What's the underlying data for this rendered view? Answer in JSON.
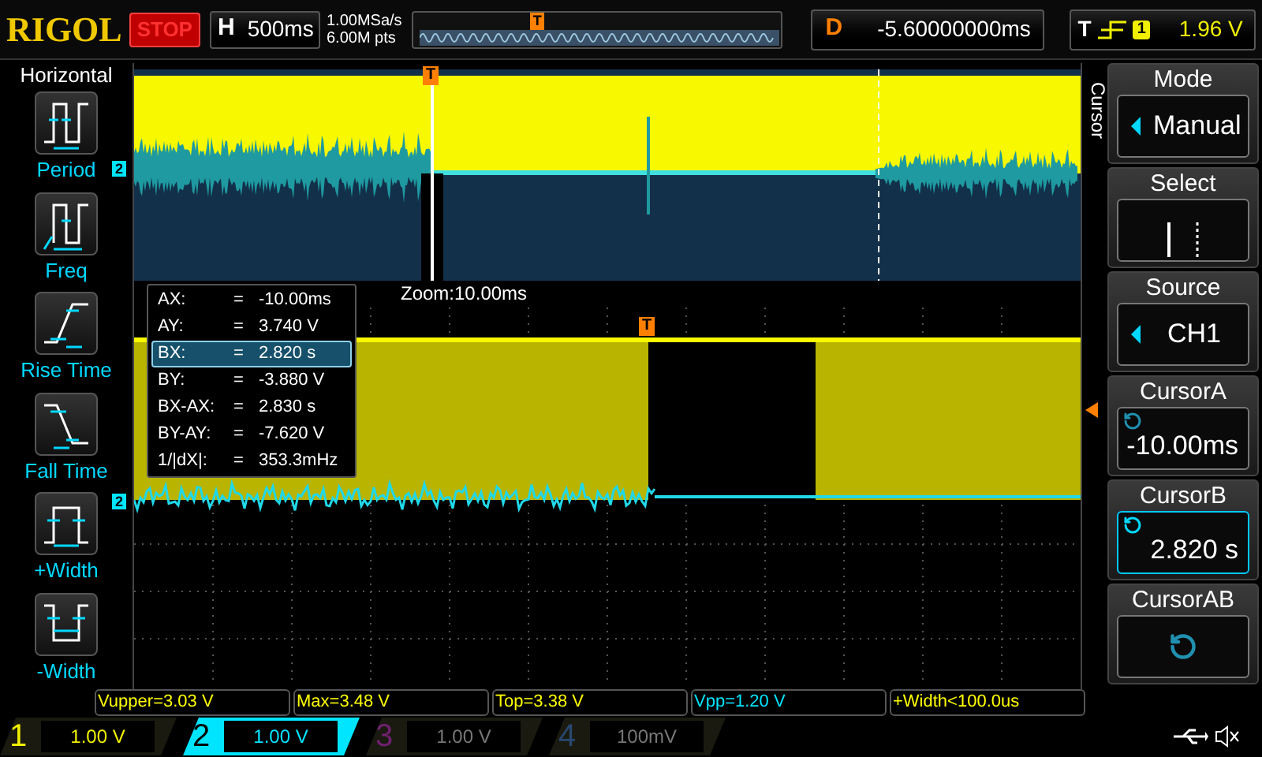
{
  "header": {
    "brand": "RIGOL",
    "run_state": "STOP",
    "timebase_label": "H",
    "timebase": "500ms",
    "sample_rate": "1.00MSa/s",
    "memory_depth": "6.00M pts",
    "trigger_marker": "T",
    "delay_label": "D",
    "delay": "-5.60000000ms",
    "trigger_label": "T",
    "trigger_source": "1",
    "trigger_level": "1.96 V"
  },
  "left_menu": {
    "title": "Horizontal",
    "items": [
      {
        "label": "Period",
        "kind": "period"
      },
      {
        "label": "Freq",
        "kind": "freq"
      },
      {
        "label": "Rise Time",
        "kind": "rise"
      },
      {
        "label": "Fall Time",
        "kind": "fall"
      },
      {
        "label": "+Width",
        "kind": "pwidth"
      },
      {
        "label": "-Width",
        "kind": "nwidth"
      }
    ]
  },
  "overview": {
    "trigger_marker": "T",
    "channel_marker": "2"
  },
  "zoom_label": "Zoom:10.00ms",
  "main": {
    "trigger_marker": "T",
    "channel_marker": "2"
  },
  "cursor_table": [
    {
      "name": "AX:",
      "eq": "=",
      "value": "-10.00ms",
      "selected": false
    },
    {
      "name": "AY:",
      "eq": "=",
      "value": "3.740 V",
      "selected": false
    },
    {
      "name": "BX:",
      "eq": "=",
      "value": "2.820 s",
      "selected": true
    },
    {
      "name": "BY:",
      "eq": "=",
      "value": "-3.880 V",
      "selected": false
    },
    {
      "name": "BX-AX:",
      "eq": "=",
      "value": "2.830 s",
      "selected": false
    },
    {
      "name": "BY-AY:",
      "eq": "=",
      "value": "-7.620 V",
      "selected": false
    },
    {
      "name": "1/|dX|:",
      "eq": "=",
      "value": "353.3mHz",
      "selected": false
    }
  ],
  "side_tab": "Cursor",
  "right_menu": [
    {
      "title": "Mode",
      "kind": "select",
      "value": "Manual",
      "selected": false
    },
    {
      "title": "Select",
      "kind": "cursor-select",
      "selected": false
    },
    {
      "title": "Source",
      "kind": "select",
      "value": "CH1",
      "selected": false
    },
    {
      "title": "CursorA",
      "kind": "knob",
      "value": "-10.00ms",
      "selected": false
    },
    {
      "title": "CursorB",
      "kind": "knob",
      "value": "2.820 s",
      "selected": true
    },
    {
      "title": "CursorAB",
      "kind": "knob-only",
      "selected": false
    }
  ],
  "measurements": [
    {
      "text": "Vupper=3.03 V",
      "color": "#ffff00"
    },
    {
      "text": "Max=3.48 V",
      "color": "#ffff00"
    },
    {
      "text": "Top=3.38 V",
      "color": "#ffff00"
    },
    {
      "text": "Vpp=1.20 V",
      "color": "#00e5ff"
    },
    {
      "text": "+Width<100.0us",
      "color": "#ffff00"
    }
  ],
  "channels": [
    {
      "number": "1",
      "scale": "1.00 V",
      "on": true,
      "selected": false,
      "color": "#f0f000"
    },
    {
      "number": "2",
      "scale": "1.00 V",
      "on": true,
      "selected": true,
      "color": "#00e5ff"
    },
    {
      "number": "3",
      "scale": "1.00 V",
      "on": false,
      "selected": false,
      "color": "#702070"
    },
    {
      "number": "4",
      "scale": "100mV",
      "on": false,
      "selected": false,
      "color": "#284870"
    }
  ]
}
